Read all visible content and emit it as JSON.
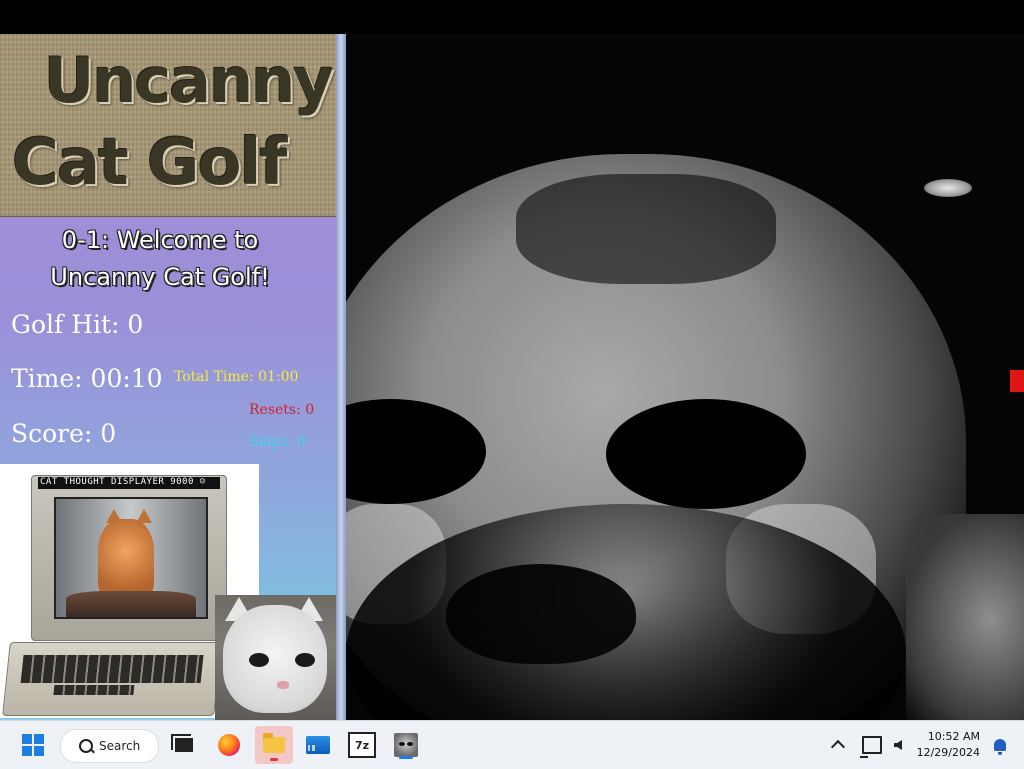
{
  "game": {
    "title_line1": "Uncanny",
    "title_line2": "Cat Golf",
    "level_title": "0-1: Welcome to Uncanny Cat Golf!",
    "stats": {
      "golf_hit": "Golf Hit: 0",
      "time": "Time: 00:10",
      "score": "Score: 0",
      "total_time": "Total Time: 01:00",
      "resets": "Resets: 0",
      "skips": "Skips: 0"
    },
    "monitor_label": "CAT THOUGHT DISPLAYER 9000 ☺",
    "colors": {
      "total_time": "#f7ec3a",
      "resets": "#d0242a",
      "skips": "#3fd6ef",
      "panel_top": "#a98ad6",
      "panel_bottom": "#86cfe8"
    }
  },
  "taskbar": {
    "search_label": "Search",
    "zip_label": "7z",
    "time": "10:52 AM",
    "date": "12/29/2024",
    "icons": [
      "windows-start-icon",
      "search-icon",
      "task-view-icon",
      "firefox-icon",
      "file-explorer-icon",
      "monitor-app-icon",
      "7zip-icon",
      "cat-game-icon",
      "chevron-up-icon",
      "network-icon",
      "volume-icon",
      "notification-bell-icon"
    ]
  }
}
